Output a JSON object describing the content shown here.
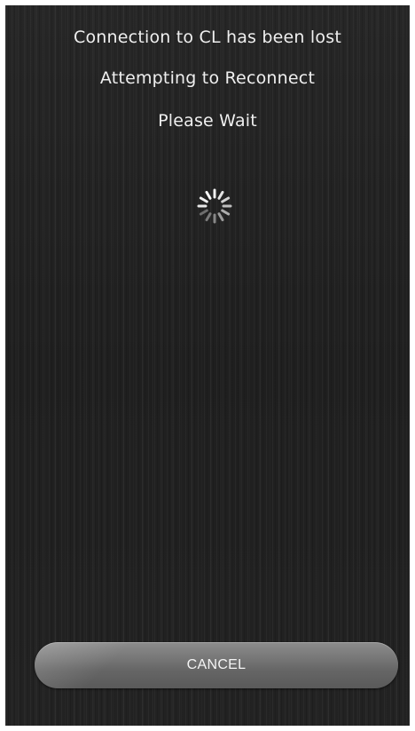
{
  "dialog": {
    "line1": "Connection to CL has been lost",
    "line2": "Attempting to Reconnect",
    "line3": "Please Wait"
  },
  "spinner": {
    "icon": "loading-spinner-icon"
  },
  "cancel_button": {
    "label": "CANCEL"
  },
  "colors": {
    "background": "#232323",
    "text": "#efefef",
    "button": "#6e6e6e"
  }
}
